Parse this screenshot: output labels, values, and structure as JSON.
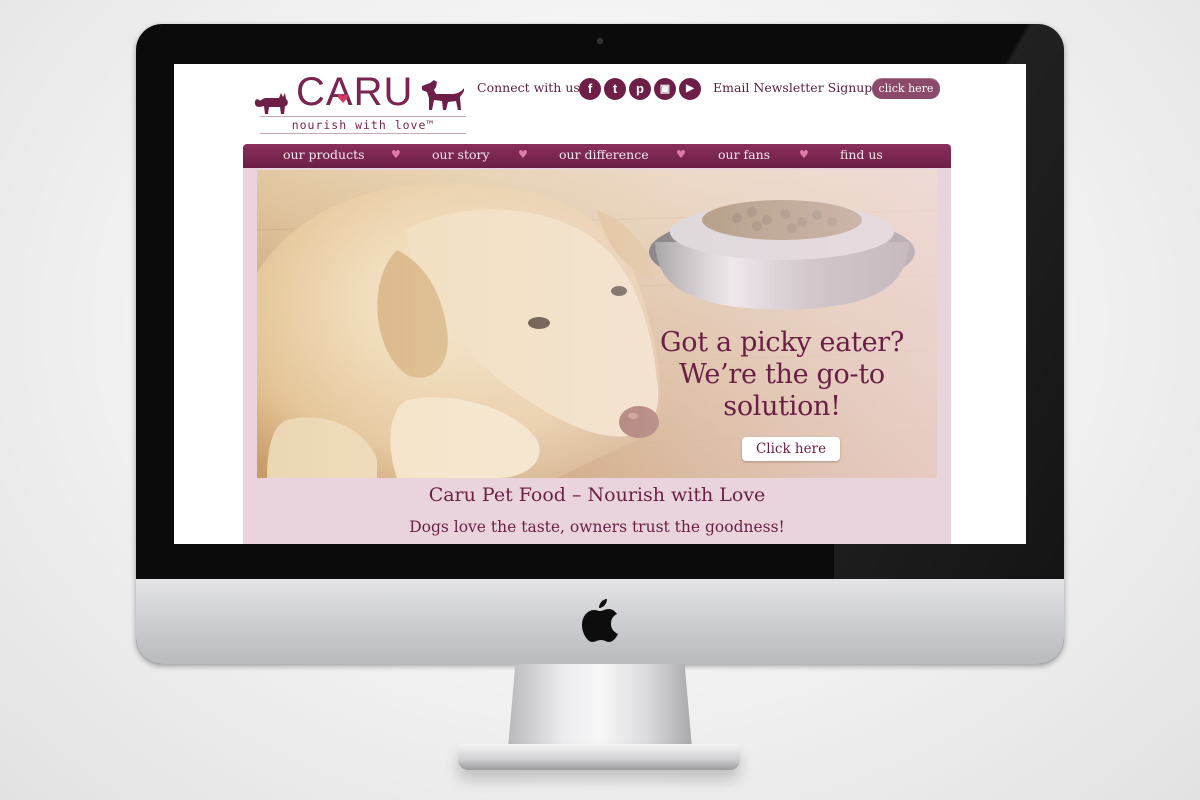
{
  "site": {
    "brand": "CARU",
    "tagline": "nourish with love™",
    "connect_label": "Connect with us",
    "social": [
      {
        "icon": "facebook-icon",
        "glyph": "f"
      },
      {
        "icon": "twitter-icon",
        "glyph": "t"
      },
      {
        "icon": "pinterest-icon",
        "glyph": "p"
      },
      {
        "icon": "instagram-icon",
        "glyph": "▣"
      },
      {
        "icon": "youtube-icon",
        "glyph": "▶"
      }
    ],
    "newsletter_label": "Email Newsletter Signup",
    "newsletter_button": "click here"
  },
  "nav": {
    "items": [
      "our products",
      "our story",
      "our difference",
      "our fans",
      "find us"
    ],
    "separator": "♥"
  },
  "hero": {
    "headline_1": "Got a picky eater?",
    "headline_2": "We’re the go-to",
    "headline_3": "solution!",
    "button": "Click here"
  },
  "main": {
    "title": "Caru Pet Food – Nourish with Love",
    "subtitle": "Dogs love the taste, owners trust the goodness!"
  },
  "colors": {
    "brand": "#6a1f45",
    "nav": "#7a2450",
    "content_bg": "#e9d4dd"
  }
}
